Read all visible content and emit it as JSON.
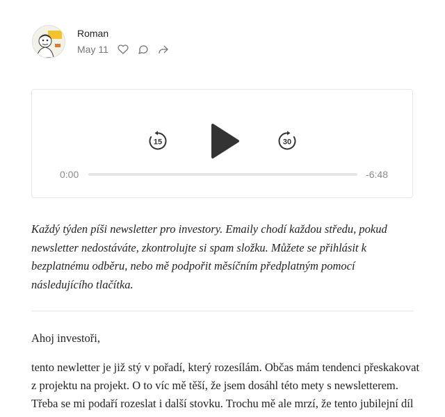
{
  "author": {
    "name": "Roman",
    "date": "May 11"
  },
  "actions": {
    "icons": [
      "heart-icon",
      "comment-icon",
      "share-icon"
    ]
  },
  "player": {
    "rewind_label": "15",
    "forward_label": "30",
    "current_time": "0:00",
    "remaining_time": "-6:48",
    "progress": 0
  },
  "article": {
    "intro": "Každý týden píši newsletter pro investory. Emaily chodí každou středu, pokud newsletter nedostáváte, zkontrolujte si spam složku. Můžete se přihlásit k bezplatnému odběru, nebo mě podpořit měsíčním předplatným pomocí následujícího tlačítka.",
    "greeting": "Ahoj investoři,",
    "paragraph": "tento newletter je již stý v pořadí, který rozesílám. Občas mám tendenci přeskakovat z projektu na projekt. O to víc mě těší, že jsem dosáhl této mety s newsletterem. Třeba se mi podaří rozeslat i další stovku. Trochu mě ale mrzí, že tento jubilejní díl"
  }
}
